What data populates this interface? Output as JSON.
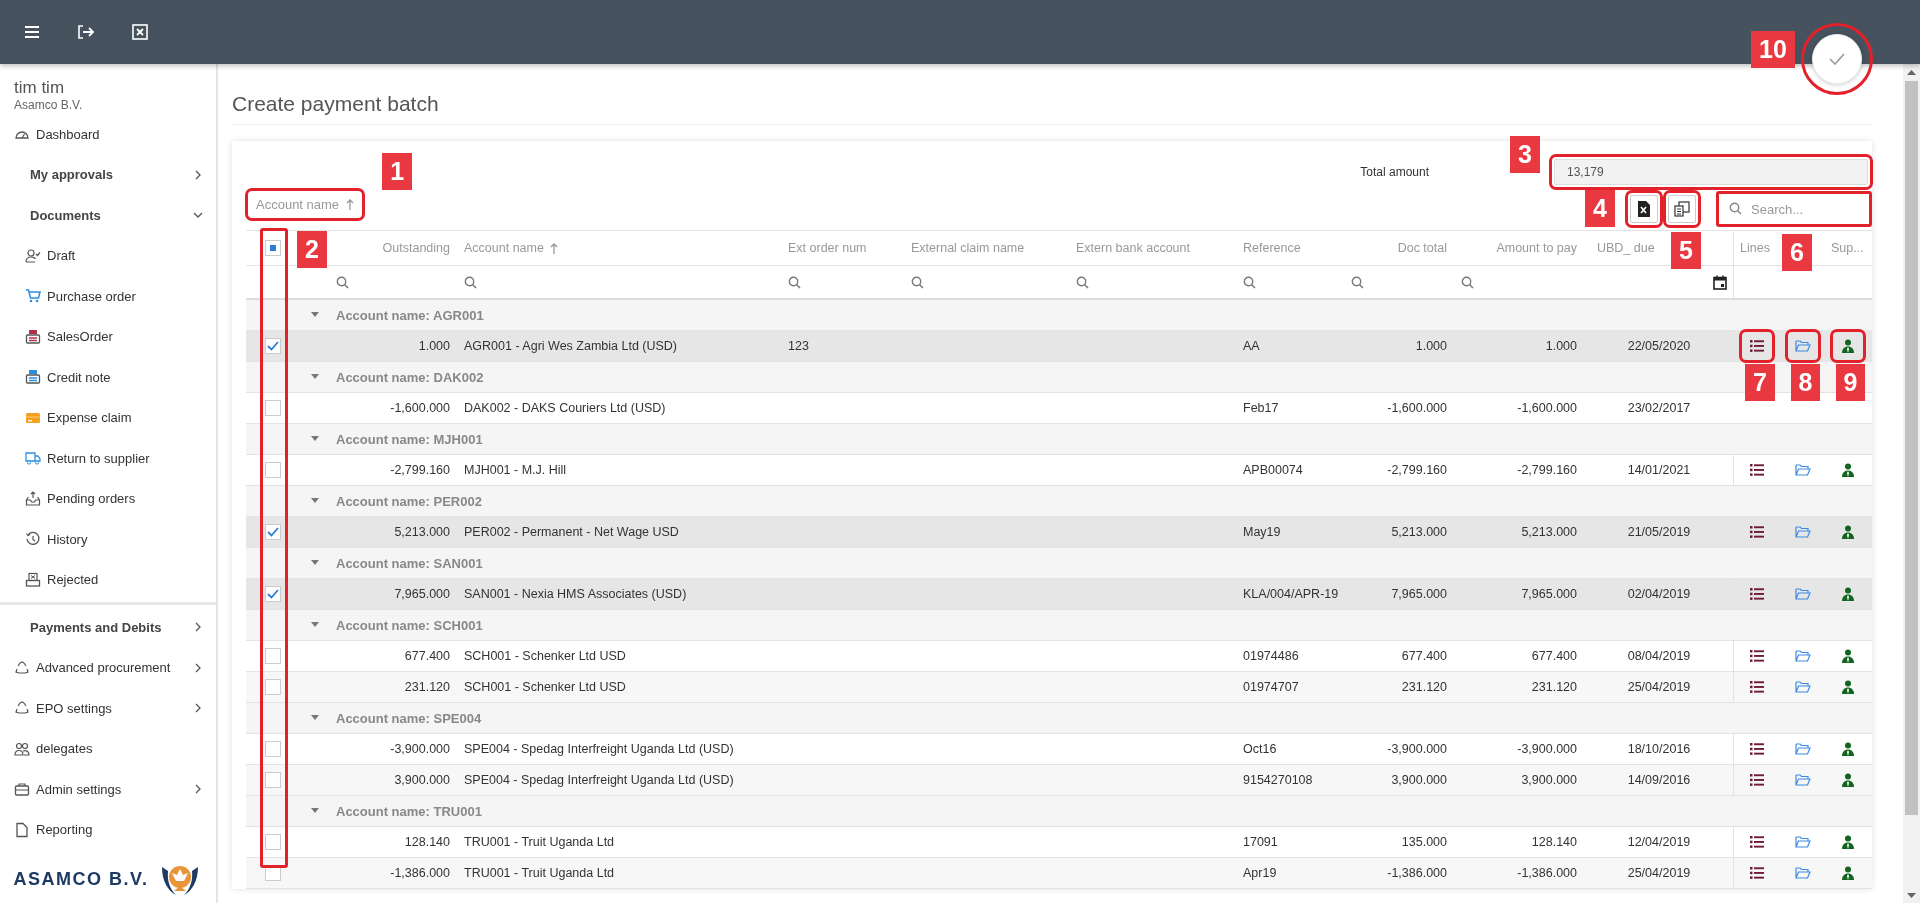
{
  "top_bar": {
    "fab_callout": "10"
  },
  "user": {
    "name": "tim tim",
    "company": "Asamco B.V."
  },
  "sidebar": {
    "items": [
      {
        "label": "Dashboard"
      },
      {
        "label": "My approvals",
        "expanded": false
      },
      {
        "label": "Documents",
        "expanded": true,
        "children": [
          {
            "label": "Draft"
          },
          {
            "label": "Purchase order"
          },
          {
            "label": "SalesOrder"
          },
          {
            "label": "Credit note"
          },
          {
            "label": "Expense claim"
          },
          {
            "label": "Return to supplier"
          },
          {
            "label": "Pending orders"
          },
          {
            "label": "History"
          },
          {
            "label": "Rejected"
          }
        ]
      },
      {
        "label": "Payments and Debits",
        "expanded": false
      },
      {
        "label": "Advanced procurement",
        "expanded": false
      },
      {
        "label": "EPO settings",
        "expanded": false
      },
      {
        "label": "delegates"
      },
      {
        "label": "Admin settings",
        "expanded": false
      },
      {
        "label": "Reporting"
      }
    ]
  },
  "logo": {
    "text": "ASAMCO B.V."
  },
  "page": {
    "title": "Create payment batch"
  },
  "total": {
    "label": "Total amount",
    "value": "13,179",
    "callout": "3"
  },
  "sort_chip": {
    "label": "Account name",
    "sorted": true,
    "callout": "1"
  },
  "toolbar": {
    "export_callout": "4",
    "columns_callout": "5",
    "search": {
      "placeholder": "Search...",
      "callout": "6"
    }
  },
  "table": {
    "select_all_partial": true,
    "select_callout": "2",
    "columns": [
      {
        "label": "Outstanding",
        "kind": "number",
        "sorted": false
      },
      {
        "label": "Account name",
        "kind": "text",
        "sorted": true
      },
      {
        "label": "Ext order num",
        "kind": "text",
        "sorted": false
      },
      {
        "label": "External claim name",
        "kind": "text",
        "sorted": false
      },
      {
        "label": "Extern bank account",
        "kind": "text",
        "sorted": false
      },
      {
        "label": "Reference",
        "kind": "text",
        "sorted": false
      },
      {
        "label": "Doc total",
        "kind": "number",
        "sorted": false
      },
      {
        "label": "Amount to pay",
        "kind": "number",
        "sorted": false
      },
      {
        "label": "UBD_ due",
        "kind": "date",
        "sorted": false
      },
      {
        "label": "Lines",
        "kind": "lines",
        "sorted": false
      },
      {
        "kind": "folder",
        "sorted": false
      },
      {
        "label": "Sup...",
        "kind": "person",
        "sorted": false
      }
    ],
    "groups": [
      {
        "label": "Account name: AGR001",
        "expanded": true,
        "rows": [
          {
            "checked": true,
            "actions": true,
            "callouts": [
              "7",
              "8",
              "9"
            ],
            "outstanding": "1.000",
            "account": "AGR001 - Agri Wes Zambia Ltd (USD)",
            "ext_order": "123",
            "reference": "AA",
            "doc_total": "1.000",
            "amount": "1.000",
            "due": "22/05/2020"
          }
        ]
      },
      {
        "label": "Account name: DAK002",
        "expanded": true,
        "rows": [
          {
            "checked": false,
            "actions": false,
            "outstanding": "-1,600.000",
            "account": "DAK002 - DAKS Couriers Ltd (USD)",
            "reference": "Feb17",
            "doc_total": "-1,600.000",
            "amount": "-1,600.000",
            "due": "23/02/2017"
          }
        ]
      },
      {
        "label": "Account name: MJH001",
        "expanded": true,
        "rows": [
          {
            "checked": false,
            "actions": true,
            "outstanding": "-2,799.160",
            "account": "MJH001 - M.J. Hill",
            "reference": "APB00074",
            "doc_total": "-2,799.160",
            "amount": "-2,799.160",
            "due": "14/01/2021"
          }
        ]
      },
      {
        "label": "Account name: PER002",
        "expanded": true,
        "rows": [
          {
            "checked": true,
            "actions": true,
            "outstanding": "5,213.000",
            "account": "PER002 - Permanent - Net Wage USD",
            "reference": "May19",
            "doc_total": "5,213.000",
            "amount": "5,213.000",
            "due": "21/05/2019"
          }
        ]
      },
      {
        "label": "Account name: SAN001",
        "expanded": true,
        "rows": [
          {
            "checked": true,
            "actions": true,
            "outstanding": "7,965.000",
            "account": "SAN001 - Nexia HMS Associates (USD)",
            "reference": "KLA/004/APR-19",
            "doc_total": "7,965.000",
            "amount": "7,965.000",
            "due": "02/04/2019"
          }
        ]
      },
      {
        "label": "Account name: SCH001",
        "expanded": true,
        "rows": [
          {
            "checked": false,
            "actions": true,
            "outstanding": "677.400",
            "account": "SCH001 - Schenker Ltd USD",
            "reference": "01974486",
            "doc_total": "677.400",
            "amount": "677.400",
            "due": "08/04/2019"
          },
          {
            "checked": false,
            "actions": true,
            "outstanding": "231.120",
            "account": "SCH001 - Schenker Ltd USD",
            "reference": "01974707",
            "doc_total": "231.120",
            "amount": "231.120",
            "due": "25/04/2019"
          }
        ]
      },
      {
        "label": "Account name: SPE004",
        "expanded": true,
        "rows": [
          {
            "checked": false,
            "actions": true,
            "outstanding": "-3,900.000",
            "account": "SPE004 - Spedag Interfreight Uganda Ltd (USD)",
            "reference": "Oct16",
            "doc_total": "-3,900.000",
            "amount": "-3,900.000",
            "due": "18/10/2016"
          },
          {
            "checked": false,
            "actions": true,
            "outstanding": "3,900.000",
            "account": "SPE004 - Spedag Interfreight Uganda Ltd (USD)",
            "reference": "9154270108",
            "doc_total": "3,900.000",
            "amount": "3,900.000",
            "due": "14/09/2016"
          }
        ]
      },
      {
        "label": "Account name: TRU001",
        "expanded": true,
        "rows": [
          {
            "checked": false,
            "actions": true,
            "outstanding": "128.140",
            "account": "TRU001 - Truit Uganda Ltd",
            "reference": "17091",
            "doc_total": "135.000",
            "amount": "128.140",
            "due": "12/04/2019"
          },
          {
            "checked": false,
            "actions": true,
            "outstanding": "-1,386.000",
            "account": "TRU001 - Truit Uganda Ltd",
            "reference": "Apr19",
            "doc_total": "-1,386.000",
            "amount": "-1,386.000",
            "due": "25/04/2019"
          }
        ]
      }
    ]
  }
}
